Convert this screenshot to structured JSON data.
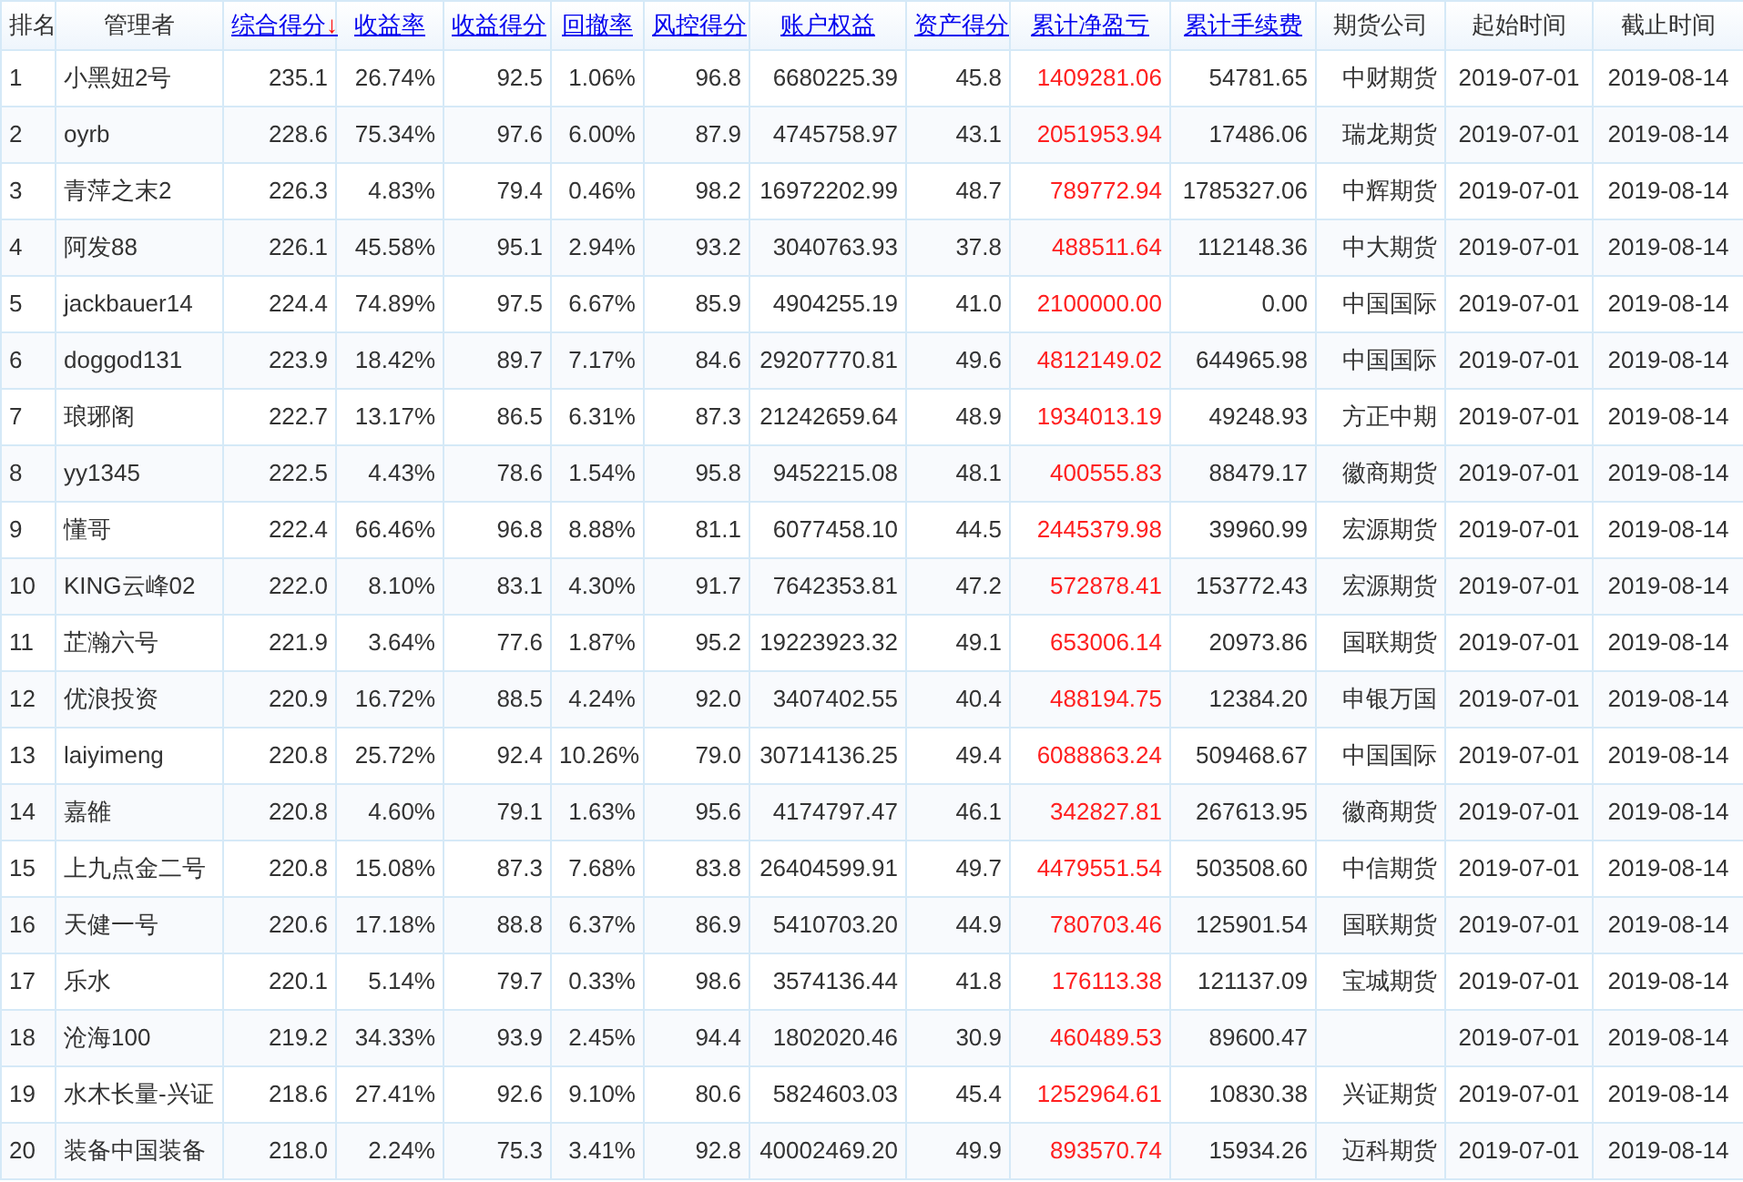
{
  "table": {
    "columns": [
      {
        "label": "排名",
        "sortable": false
      },
      {
        "label": "管理者",
        "sortable": false
      },
      {
        "label": "综合得分",
        "sortable": true,
        "sort_arrow": "↓"
      },
      {
        "label": "收益率",
        "sortable": true
      },
      {
        "label": "收益得分",
        "sortable": true
      },
      {
        "label": "回撤率",
        "sortable": true
      },
      {
        "label": "风控得分",
        "sortable": true
      },
      {
        "label": "账户权益",
        "sortable": true
      },
      {
        "label": "资产得分",
        "sortable": true
      },
      {
        "label": "累计净盈亏",
        "sortable": true
      },
      {
        "label": "累计手续费",
        "sortable": true
      },
      {
        "label": "期货公司",
        "sortable": false
      },
      {
        "label": "起始时间",
        "sortable": false
      },
      {
        "label": "截止时间",
        "sortable": false
      }
    ],
    "rows": [
      {
        "rank": "1",
        "manager": "小黑妞2号",
        "score": "235.1",
        "return": "26.74%",
        "return_score": "92.5",
        "drawdown": "1.06%",
        "risk_score": "96.8",
        "equity": "6680225.39",
        "asset_score": "45.8",
        "net_pnl": "1409281.06",
        "fees": "54781.65",
        "company": "中财期货",
        "start": "2019-07-01",
        "end": "2019-08-14"
      },
      {
        "rank": "2",
        "manager": "oyrb",
        "score": "228.6",
        "return": "75.34%",
        "return_score": "97.6",
        "drawdown": "6.00%",
        "risk_score": "87.9",
        "equity": "4745758.97",
        "asset_score": "43.1",
        "net_pnl": "2051953.94",
        "fees": "17486.06",
        "company": "瑞龙期货",
        "start": "2019-07-01",
        "end": "2019-08-14"
      },
      {
        "rank": "3",
        "manager": "青萍之末2",
        "score": "226.3",
        "return": "4.83%",
        "return_score": "79.4",
        "drawdown": "0.46%",
        "risk_score": "98.2",
        "equity": "16972202.99",
        "asset_score": "48.7",
        "net_pnl": "789772.94",
        "fees": "1785327.06",
        "company": "中辉期货",
        "start": "2019-07-01",
        "end": "2019-08-14"
      },
      {
        "rank": "4",
        "manager": "阿发88",
        "score": "226.1",
        "return": "45.58%",
        "return_score": "95.1",
        "drawdown": "2.94%",
        "risk_score": "93.2",
        "equity": "3040763.93",
        "asset_score": "37.8",
        "net_pnl": "488511.64",
        "fees": "112148.36",
        "company": "中大期货",
        "start": "2019-07-01",
        "end": "2019-08-14"
      },
      {
        "rank": "5",
        "manager": "jackbauer14",
        "score": "224.4",
        "return": "74.89%",
        "return_score": "97.5",
        "drawdown": "6.67%",
        "risk_score": "85.9",
        "equity": "4904255.19",
        "asset_score": "41.0",
        "net_pnl": "2100000.00",
        "fees": "0.00",
        "company": "中国国际",
        "start": "2019-07-01",
        "end": "2019-08-14"
      },
      {
        "rank": "6",
        "manager": "doggod131",
        "score": "223.9",
        "return": "18.42%",
        "return_score": "89.7",
        "drawdown": "7.17%",
        "risk_score": "84.6",
        "equity": "29207770.81",
        "asset_score": "49.6",
        "net_pnl": "4812149.02",
        "fees": "644965.98",
        "company": "中国国际",
        "start": "2019-07-01",
        "end": "2019-08-14"
      },
      {
        "rank": "7",
        "manager": "琅琊阁",
        "score": "222.7",
        "return": "13.17%",
        "return_score": "86.5",
        "drawdown": "6.31%",
        "risk_score": "87.3",
        "equity": "21242659.64",
        "asset_score": "48.9",
        "net_pnl": "1934013.19",
        "fees": "49248.93",
        "company": "方正中期",
        "start": "2019-07-01",
        "end": "2019-08-14"
      },
      {
        "rank": "8",
        "manager": "yy1345",
        "score": "222.5",
        "return": "4.43%",
        "return_score": "78.6",
        "drawdown": "1.54%",
        "risk_score": "95.8",
        "equity": "9452215.08",
        "asset_score": "48.1",
        "net_pnl": "400555.83",
        "fees": "88479.17",
        "company": "徽商期货",
        "start": "2019-07-01",
        "end": "2019-08-14"
      },
      {
        "rank": "9",
        "manager": "懂哥",
        "score": "222.4",
        "return": "66.46%",
        "return_score": "96.8",
        "drawdown": "8.88%",
        "risk_score": "81.1",
        "equity": "6077458.10",
        "asset_score": "44.5",
        "net_pnl": "2445379.98",
        "fees": "39960.99",
        "company": "宏源期货",
        "start": "2019-07-01",
        "end": "2019-08-14"
      },
      {
        "rank": "10",
        "manager": "KING云峰02",
        "score": "222.0",
        "return": "8.10%",
        "return_score": "83.1",
        "drawdown": "4.30%",
        "risk_score": "91.7",
        "equity": "7642353.81",
        "asset_score": "47.2",
        "net_pnl": "572878.41",
        "fees": "153772.43",
        "company": "宏源期货",
        "start": "2019-07-01",
        "end": "2019-08-14"
      },
      {
        "rank": "11",
        "manager": "芷瀚六号",
        "score": "221.9",
        "return": "3.64%",
        "return_score": "77.6",
        "drawdown": "1.87%",
        "risk_score": "95.2",
        "equity": "19223923.32",
        "asset_score": "49.1",
        "net_pnl": "653006.14",
        "fees": "20973.86",
        "company": "国联期货",
        "start": "2019-07-01",
        "end": "2019-08-14"
      },
      {
        "rank": "12",
        "manager": "优浪投资",
        "score": "220.9",
        "return": "16.72%",
        "return_score": "88.5",
        "drawdown": "4.24%",
        "risk_score": "92.0",
        "equity": "3407402.55",
        "asset_score": "40.4",
        "net_pnl": "488194.75",
        "fees": "12384.20",
        "company": "申银万国",
        "start": "2019-07-01",
        "end": "2019-08-14"
      },
      {
        "rank": "13",
        "manager": "laiyimeng",
        "score": "220.8",
        "return": "25.72%",
        "return_score": "92.4",
        "drawdown": "10.26%",
        "risk_score": "79.0",
        "equity": "30714136.25",
        "asset_score": "49.4",
        "net_pnl": "6088863.24",
        "fees": "509468.67",
        "company": "中国国际",
        "start": "2019-07-01",
        "end": "2019-08-14"
      },
      {
        "rank": "14",
        "manager": "嘉雒",
        "score": "220.8",
        "return": "4.60%",
        "return_score": "79.1",
        "drawdown": "1.63%",
        "risk_score": "95.6",
        "equity": "4174797.47",
        "asset_score": "46.1",
        "net_pnl": "342827.81",
        "fees": "267613.95",
        "company": "徽商期货",
        "start": "2019-07-01",
        "end": "2019-08-14"
      },
      {
        "rank": "15",
        "manager": "上九点金二号",
        "score": "220.8",
        "return": "15.08%",
        "return_score": "87.3",
        "drawdown": "7.68%",
        "risk_score": "83.8",
        "equity": "26404599.91",
        "asset_score": "49.7",
        "net_pnl": "4479551.54",
        "fees": "503508.60",
        "company": "中信期货",
        "start": "2019-07-01",
        "end": "2019-08-14"
      },
      {
        "rank": "16",
        "manager": "天健一号",
        "score": "220.6",
        "return": "17.18%",
        "return_score": "88.8",
        "drawdown": "6.37%",
        "risk_score": "86.9",
        "equity": "5410703.20",
        "asset_score": "44.9",
        "net_pnl": "780703.46",
        "fees": "125901.54",
        "company": "国联期货",
        "start": "2019-07-01",
        "end": "2019-08-14"
      },
      {
        "rank": "17",
        "manager": "乐水",
        "score": "220.1",
        "return": "5.14%",
        "return_score": "79.7",
        "drawdown": "0.33%",
        "risk_score": "98.6",
        "equity": "3574136.44",
        "asset_score": "41.8",
        "net_pnl": "176113.38",
        "fees": "121137.09",
        "company": "宝城期货",
        "start": "2019-07-01",
        "end": "2019-08-14"
      },
      {
        "rank": "18",
        "manager": "沧海100",
        "score": "219.2",
        "return": "34.33%",
        "return_score": "93.9",
        "drawdown": "2.45%",
        "risk_score": "94.4",
        "equity": "1802020.46",
        "asset_score": "30.9",
        "net_pnl": "460489.53",
        "fees": "89600.47",
        "start": "2019-07-01",
        "end": "2019-08-14"
      },
      {
        "rank": "19",
        "manager": "水木长量-兴证",
        "score": "218.6",
        "return": "27.41%",
        "return_score": "92.6",
        "drawdown": "9.10%",
        "risk_score": "80.6",
        "equity": "5824603.03",
        "asset_score": "45.4",
        "net_pnl": "1252964.61",
        "fees": "10830.38",
        "company": "兴证期货",
        "start": "2019-07-01",
        "end": "2019-08-14"
      },
      {
        "rank": "20",
        "manager": "装备中国装备",
        "score": "218.0",
        "return": "2.24%",
        "return_score": "75.3",
        "drawdown": "3.41%",
        "risk_score": "92.8",
        "equity": "40002469.20",
        "asset_score": "49.9",
        "net_pnl": "893570.74",
        "fees": "15934.26",
        "company": "迈科期货",
        "start": "2019-07-01",
        "end": "2019-08-14"
      }
    ]
  }
}
